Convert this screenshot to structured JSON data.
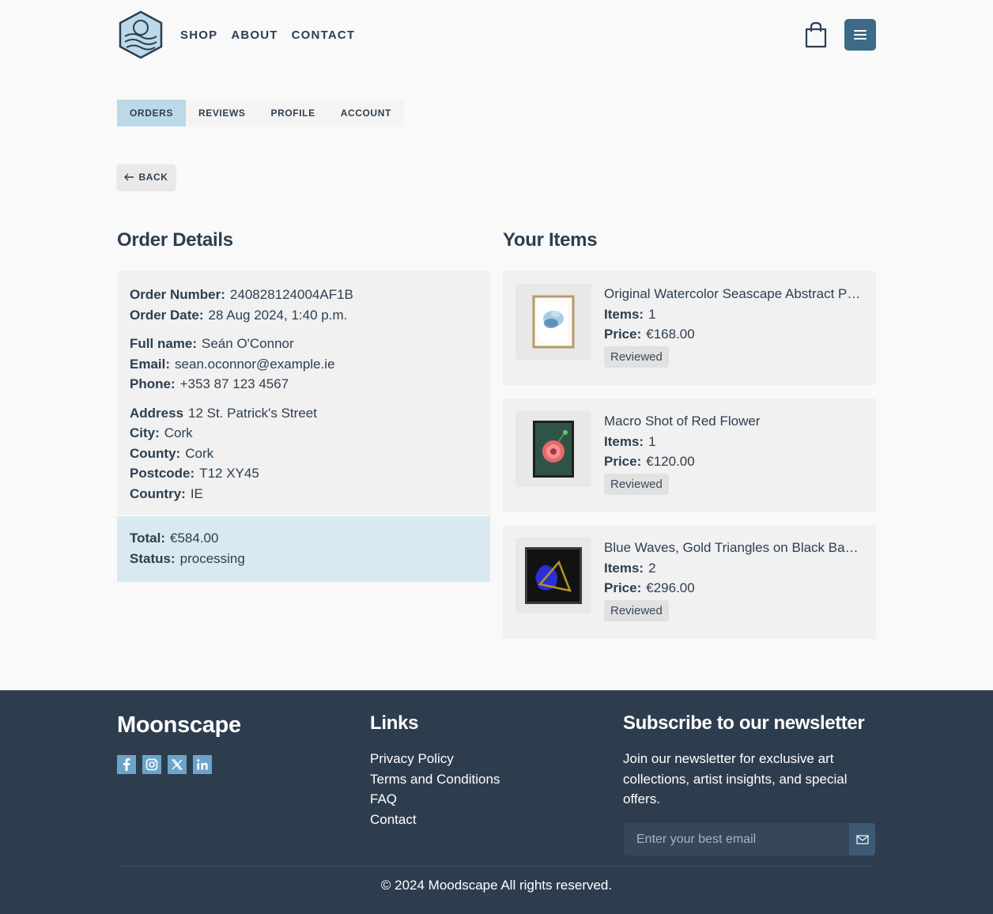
{
  "nav": {
    "links": [
      "SHOP",
      "ABOUT",
      "CONTACT"
    ]
  },
  "tabs": [
    {
      "label": "ORDERS",
      "active": true
    },
    {
      "label": "REVIEWS",
      "active": false
    },
    {
      "label": "PROFILE",
      "active": false
    },
    {
      "label": "ACCOUNT",
      "active": false
    }
  ],
  "back_label": "BACK",
  "order_details": {
    "heading": "Order Details",
    "order_number_label": "Order Number:",
    "order_number": "240828124004AF1B",
    "order_date_label": "Order Date:",
    "order_date": "28 Aug 2024, 1:40 p.m.",
    "full_name_label": "Full name:",
    "full_name": "Seán O'Connor",
    "email_label": "Email:",
    "email": "sean.oconnor@example.ie",
    "phone_label": "Phone:",
    "phone": "+353 87 123 4567",
    "address_label": "Address",
    "address": "12 St. Patrick's Street",
    "city_label": "City:",
    "city": "Cork",
    "county_label": "County:",
    "county": "Cork",
    "postcode_label": "Postcode:",
    "postcode": "T12 XY45",
    "country_label": "Country:",
    "country": "IE",
    "total_label": "Total:",
    "total": "€584.00",
    "status_label": "Status:",
    "status": "processing"
  },
  "items": {
    "heading": "Your Items",
    "list": [
      {
        "title": "Original Watercolor Seascape Abstract Painting",
        "items_label": "Items:",
        "qty": "1",
        "price_label": "Price:",
        "price": "€168.00",
        "badge": "Reviewed"
      },
      {
        "title": "Macro Shot of Red Flower",
        "items_label": "Items:",
        "qty": "1",
        "price_label": "Price:",
        "price": "€120.00",
        "badge": "Reviewed"
      },
      {
        "title": "Blue Waves, Gold Triangles on Black Background",
        "items_label": "Items:",
        "qty": "2",
        "price_label": "Price:",
        "price": "€296.00",
        "badge": "Reviewed"
      }
    ]
  },
  "footer": {
    "brand": "Moonscape",
    "links_heading": "Links",
    "links": [
      "Privacy Policy",
      "Terms and Conditions",
      "FAQ",
      "Contact"
    ],
    "newsletter_heading": "Subscribe to our newsletter",
    "newsletter_text": "Join our newsletter for exclusive art collections, artist insights, and special offers.",
    "email_placeholder": "Enter your best email",
    "copyright": "© 2024 Moodscape All rights reserved."
  },
  "icons": [
    "logo-icon",
    "shopping-bag-icon",
    "menu-icon",
    "arrow-left-icon",
    "facebook-icon",
    "instagram-icon",
    "x-icon",
    "linkedin-icon",
    "envelope-icon"
  ],
  "colors": {
    "accent": "#3c6a88",
    "tab_active": "#bcd9e8",
    "footer_bg": "#2e3d4e",
    "totals_bg": "#d9e9f2"
  }
}
